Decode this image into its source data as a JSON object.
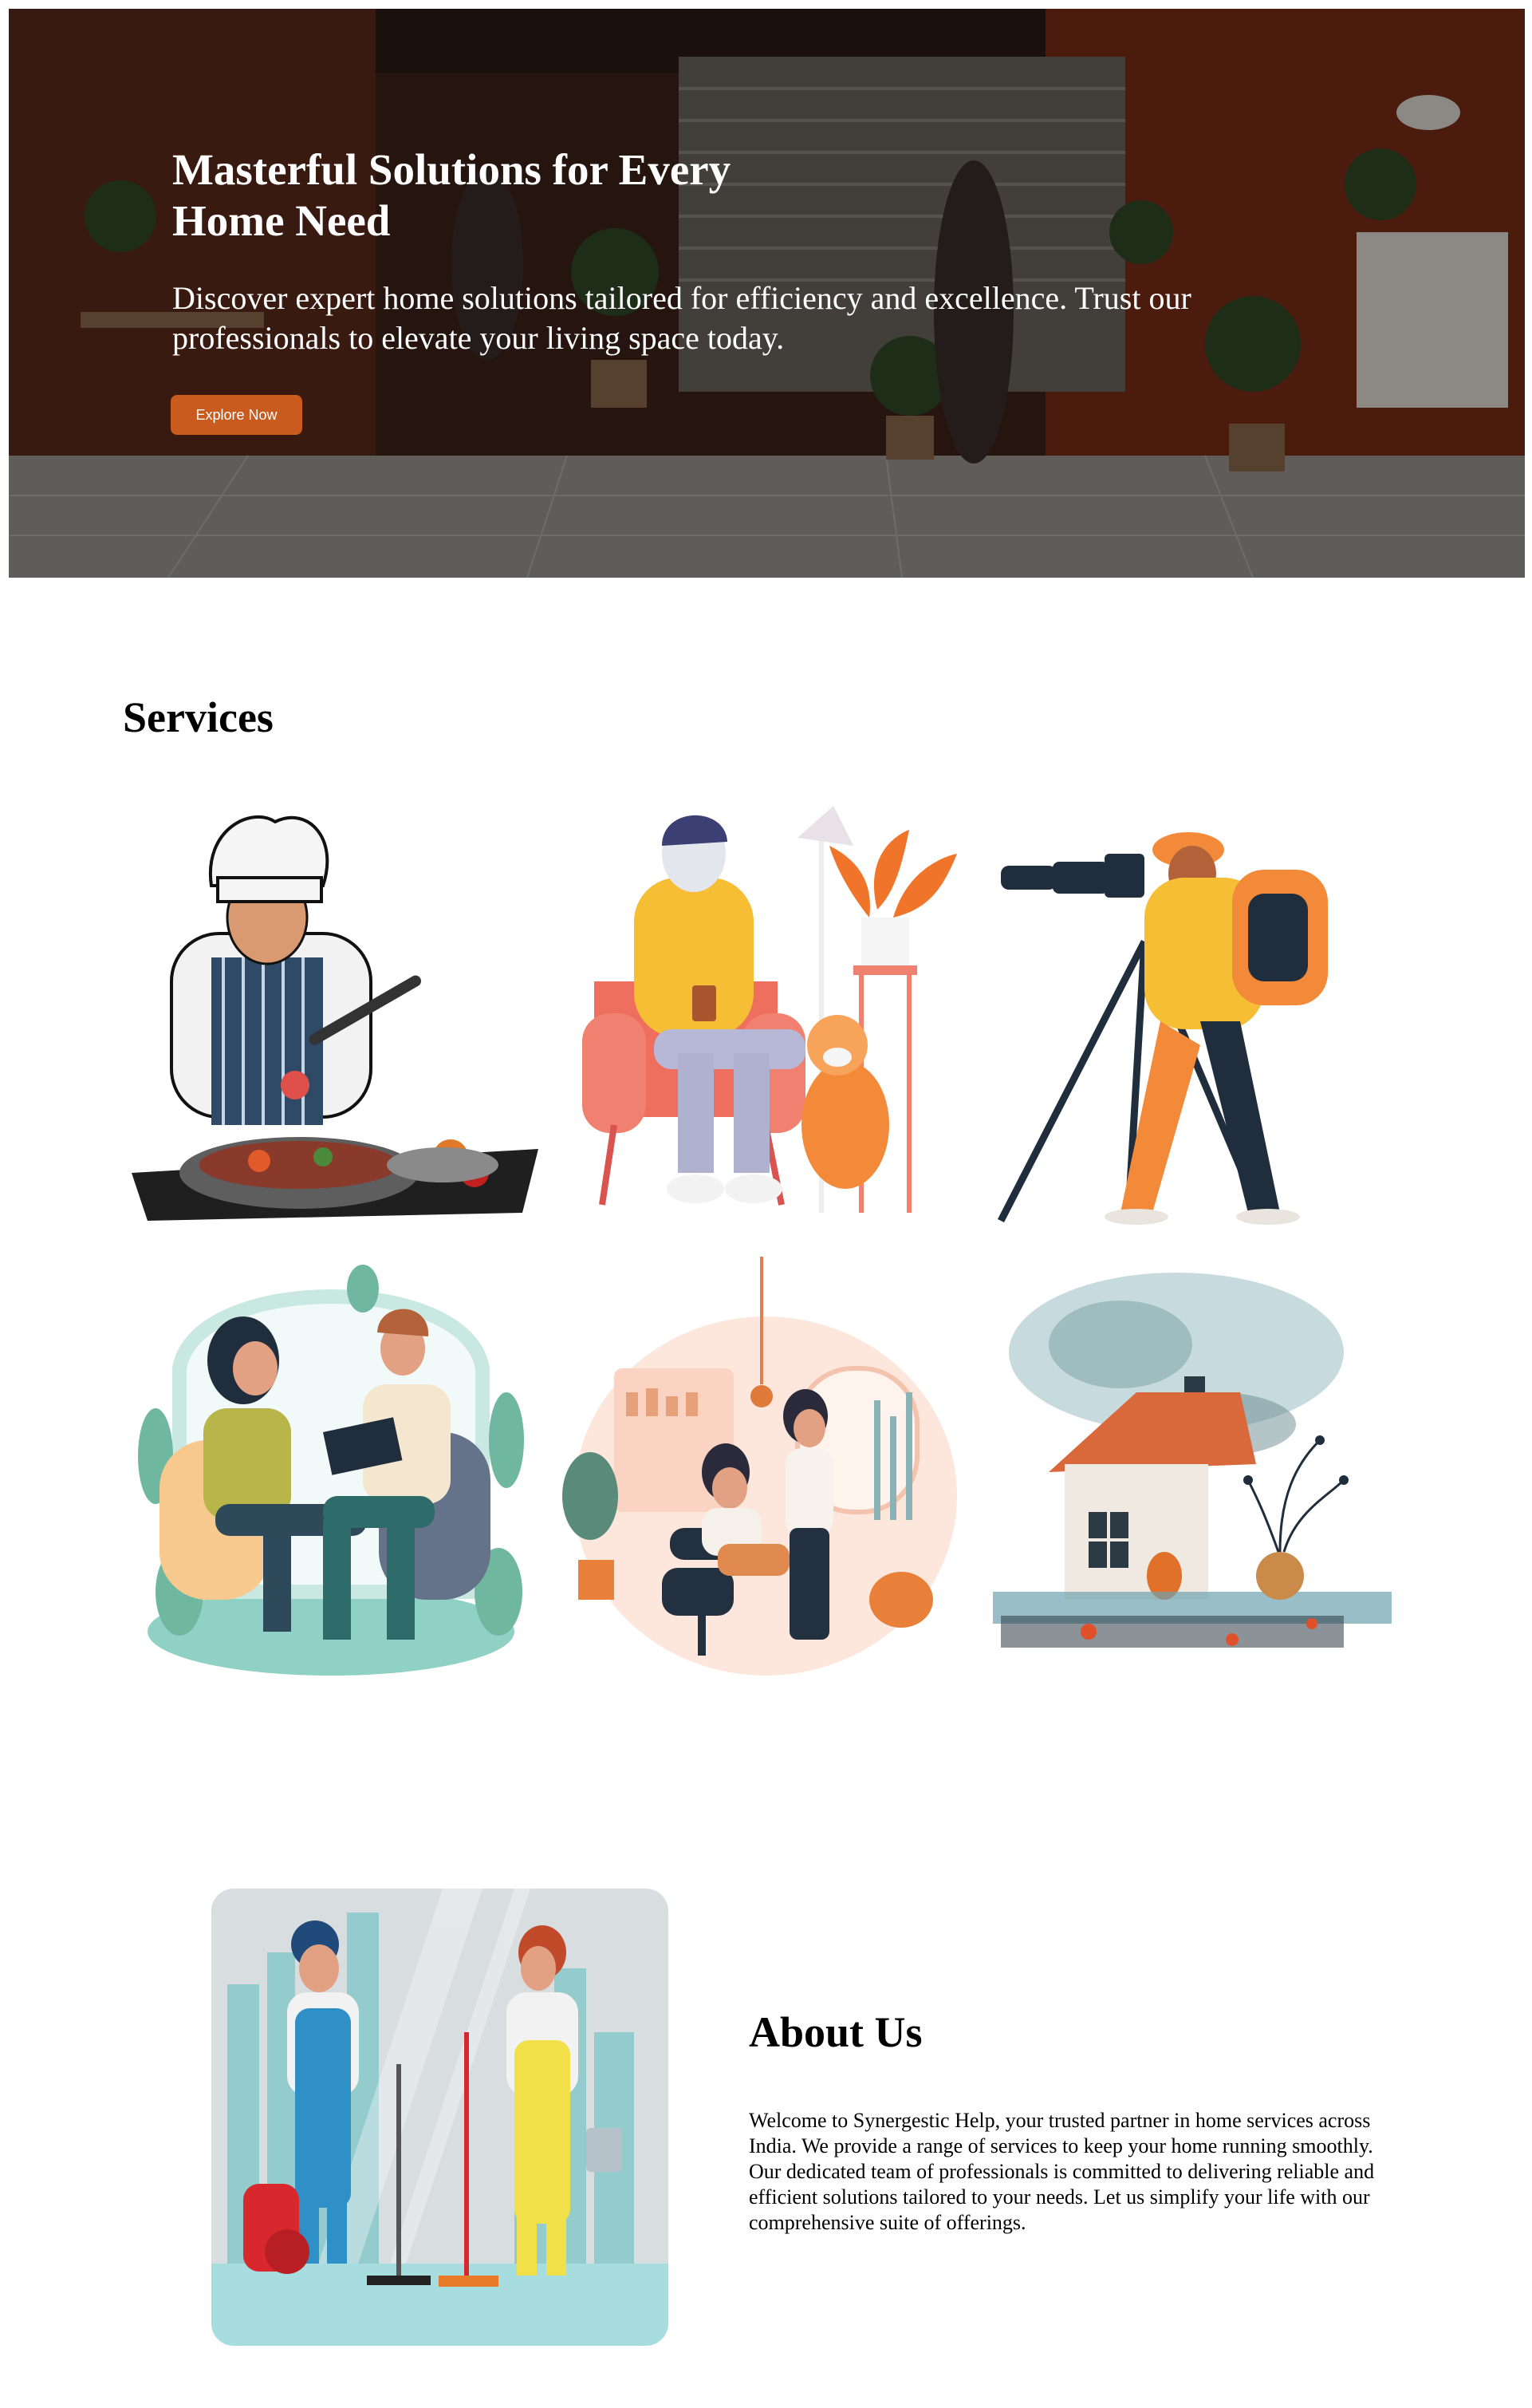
{
  "hero": {
    "title": "Masterful Solutions for Every Home Need",
    "subtitle": "Discover expert home solutions tailored for efficiency and excellence. Trust our professionals to elevate your living space today.",
    "cta_label": "Explore Now"
  },
  "services": {
    "heading": "Services",
    "items": [
      {
        "icon": "chef-cooking-illustration"
      },
      {
        "icon": "man-with-dog-in-armchair-illustration"
      },
      {
        "icon": "photographer-with-tripod-illustration"
      },
      {
        "icon": "counseling-session-illustration"
      },
      {
        "icon": "beauty-salon-illustration"
      },
      {
        "icon": "watercolor-house-illustration"
      }
    ]
  },
  "about": {
    "heading": "About Us",
    "paragraph_1": "Welcome to Synergestic Help, your trusted partner in home services across India. We provide a range of services to keep your home running smoothly.",
    "paragraph_2": "Our dedicated team of professionals is committed to delivering reliable and efficient solutions tailored to your needs. Let us simplify your life with our comprehensive suite of offerings."
  },
  "colors": {
    "accent": "#c95b1e",
    "hero_overlay": "#2e2420"
  }
}
